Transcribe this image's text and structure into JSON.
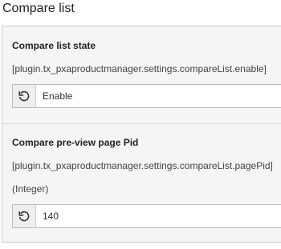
{
  "section": {
    "title": "Compare list"
  },
  "settings": [
    {
      "label": "Compare list state",
      "key": "[plugin.tx_pxaproductmanager.settings.compareList.enable]",
      "type": "",
      "value": "Enable"
    },
    {
      "label": "Compare pre-view page Pid",
      "key": "[plugin.tx_pxaproductmanager.settings.compareList.pagePid]",
      "type": "(Integer)",
      "value": "140"
    }
  ],
  "icons": {
    "reset": "undo-icon"
  }
}
